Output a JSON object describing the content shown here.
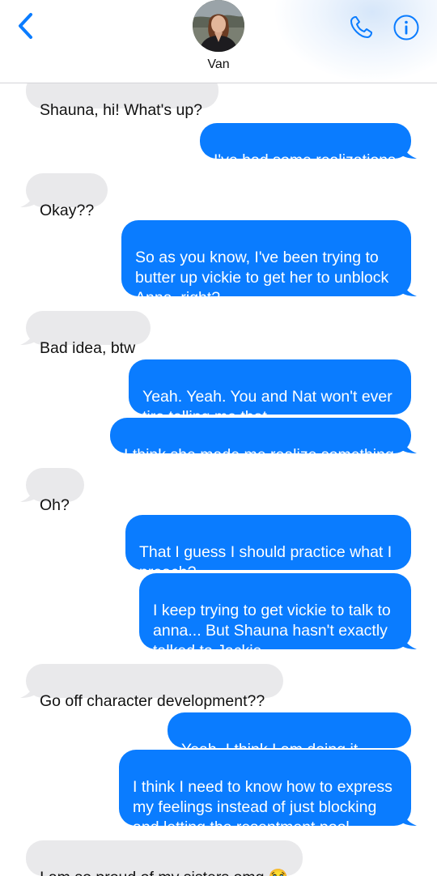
{
  "contact": {
    "name": "Van"
  },
  "colors": {
    "accent": "#0a7cff",
    "incoming_bubble": "#e9e9eb",
    "outgoing_text": "#ffffff"
  },
  "icons": {
    "back": "chevron-left-icon",
    "call": "phone-icon",
    "info": "info-icon"
  },
  "messages": [
    {
      "from": "them",
      "text": "Shauna, hi! What's up?"
    },
    {
      "from": "me",
      "text": "I've had some realizations"
    },
    {
      "from": "them",
      "text": "Okay??"
    },
    {
      "from": "me",
      "text": "So as you know, I've been trying to\nbutter up vickie to get her to unblock\nAnna, right?"
    },
    {
      "from": "them",
      "text": "Bad idea, btw"
    },
    {
      "from": "me",
      "text": "Yeah. Yeah. You and Nat won't ever\ntire telling me that."
    },
    {
      "from": "me",
      "text": "I think she made me realize something"
    },
    {
      "from": "them",
      "text": "Oh?"
    },
    {
      "from": "me",
      "text": "That I guess I should practice what I\npreach?"
    },
    {
      "from": "me",
      "text": "I keep trying to get vickie to talk to\nanna... But Shauna  hasn't exactly\ntalked to Jackie"
    },
    {
      "from": "them",
      "text": "Go off character development??"
    },
    {
      "from": "me",
      "text": "Yeah. I think I am doing it, Van!"
    },
    {
      "from": "me",
      "text": "I think I need to know how to express\nmy feelings instead of just blocking\nand letting the resentment pool"
    },
    {
      "from": "them",
      "text": "I am so proud of my sisters omg 😭"
    }
  ]
}
